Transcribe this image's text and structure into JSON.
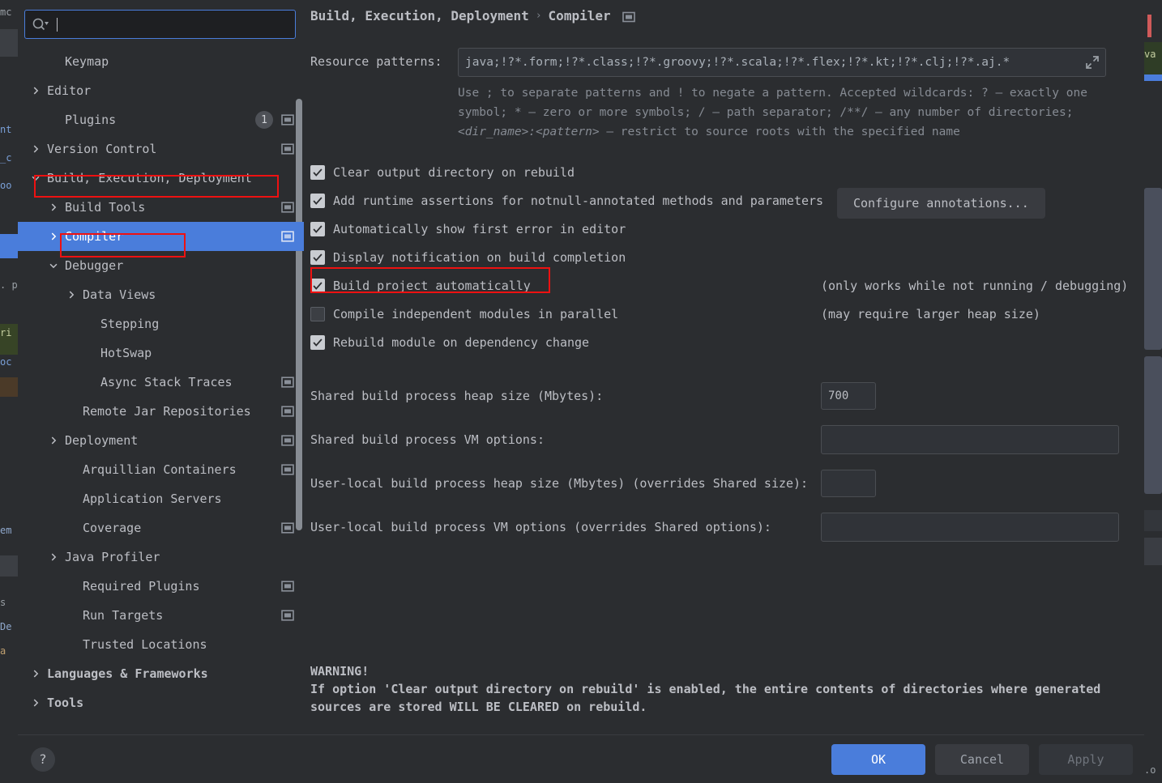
{
  "dialog": {
    "search": {
      "value": "",
      "placeholder": "",
      "icon": "search-icon"
    }
  },
  "sidebar": {
    "items": [
      {
        "label": "Keymap",
        "indent": 1,
        "arrow": "none",
        "badge": null,
        "cfg": false,
        "selected": false,
        "bold": false
      },
      {
        "label": "Editor",
        "indent": 0,
        "arrow": "right",
        "badge": null,
        "cfg": false,
        "selected": false,
        "bold": false
      },
      {
        "label": "Plugins",
        "indent": 1,
        "arrow": "none",
        "badge": "1",
        "cfg": true,
        "selected": false,
        "bold": false
      },
      {
        "label": "Version Control",
        "indent": 0,
        "arrow": "right",
        "badge": null,
        "cfg": true,
        "selected": false,
        "bold": false
      },
      {
        "label": "Build, Execution, Deployment",
        "indent": 0,
        "arrow": "down",
        "badge": null,
        "cfg": false,
        "selected": false,
        "bold": false
      },
      {
        "label": "Build Tools",
        "indent": 1,
        "arrow": "right",
        "badge": null,
        "cfg": true,
        "selected": false,
        "bold": false
      },
      {
        "label": "Compiler",
        "indent": 1,
        "arrow": "right",
        "badge": null,
        "cfg": true,
        "selected": true,
        "bold": false
      },
      {
        "label": "Debugger",
        "indent": 1,
        "arrow": "down",
        "badge": null,
        "cfg": false,
        "selected": false,
        "bold": false
      },
      {
        "label": "Data Views",
        "indent": 2,
        "arrow": "right",
        "badge": null,
        "cfg": false,
        "selected": false,
        "bold": false
      },
      {
        "label": "Stepping",
        "indent": 3,
        "arrow": "none",
        "badge": null,
        "cfg": false,
        "selected": false,
        "bold": false
      },
      {
        "label": "HotSwap",
        "indent": 3,
        "arrow": "none",
        "badge": null,
        "cfg": false,
        "selected": false,
        "bold": false
      },
      {
        "label": "Async Stack Traces",
        "indent": 3,
        "arrow": "none",
        "badge": null,
        "cfg": true,
        "selected": false,
        "bold": false
      },
      {
        "label": "Remote Jar Repositories",
        "indent": 2,
        "arrow": "none",
        "badge": null,
        "cfg": true,
        "selected": false,
        "bold": false
      },
      {
        "label": "Deployment",
        "indent": 1,
        "arrow": "right",
        "badge": null,
        "cfg": true,
        "selected": false,
        "bold": false
      },
      {
        "label": "Arquillian Containers",
        "indent": 2,
        "arrow": "none",
        "badge": null,
        "cfg": true,
        "selected": false,
        "bold": false
      },
      {
        "label": "Application Servers",
        "indent": 2,
        "arrow": "none",
        "badge": null,
        "cfg": false,
        "selected": false,
        "bold": false
      },
      {
        "label": "Coverage",
        "indent": 2,
        "arrow": "none",
        "badge": null,
        "cfg": true,
        "selected": false,
        "bold": false
      },
      {
        "label": "Java Profiler",
        "indent": 1,
        "arrow": "right",
        "badge": null,
        "cfg": false,
        "selected": false,
        "bold": false
      },
      {
        "label": "Required Plugins",
        "indent": 2,
        "arrow": "none",
        "badge": null,
        "cfg": true,
        "selected": false,
        "bold": false
      },
      {
        "label": "Run Targets",
        "indent": 2,
        "arrow": "none",
        "badge": null,
        "cfg": true,
        "selected": false,
        "bold": false
      },
      {
        "label": "Trusted Locations",
        "indent": 2,
        "arrow": "none",
        "badge": null,
        "cfg": false,
        "selected": false,
        "bold": false
      },
      {
        "label": "Languages & Frameworks",
        "indent": 0,
        "arrow": "right",
        "badge": null,
        "cfg": false,
        "selected": false,
        "bold": true
      },
      {
        "label": "Tools",
        "indent": 0,
        "arrow": "right",
        "badge": null,
        "cfg": false,
        "selected": false,
        "bold": true
      }
    ]
  },
  "main": {
    "breadcrumb": {
      "root": "Build, Execution, Deployment",
      "separator": "›",
      "leaf": "Compiler"
    },
    "resource_patterns": {
      "label": "Resource patterns:",
      "value": "*.java;!?*.form;!?*.class;!?*.groovy;!?*.scala;!?*.flex;!?*.kt;!?*.clj;!?*.aj",
      "expand_icon": "expand-icon"
    },
    "hint_line1": "Use ; to separate patterns and ! to negate a pattern. Accepted wildcards: ? — exactly one",
    "hint_line2": "symbol; * — zero or more symbols; / — path separator; /**/ — any number of directories;",
    "hint_line3_italic": "<dir_name>:<pattern>",
    "hint_line3_rest": " — restrict to source roots with the specified name",
    "checkboxes": [
      {
        "label": "Clear output directory on rebuild",
        "checked": true,
        "note": ""
      },
      {
        "label": "Add runtime assertions for notnull-annotated methods and parameters",
        "checked": true,
        "note": ""
      },
      {
        "label": "Automatically show first error in editor",
        "checked": true,
        "note": ""
      },
      {
        "label": "Display notification on build completion",
        "checked": true,
        "note": ""
      },
      {
        "label": "Build project automatically",
        "checked": true,
        "note": "(only works while not running / debugging)"
      },
      {
        "label": "Compile independent modules in parallel",
        "checked": false,
        "note": "(may require larger heap size)"
      },
      {
        "label": "Rebuild module on dependency change",
        "checked": true,
        "note": ""
      }
    ],
    "configure_annotations_label": "Configure annotations...",
    "fields": [
      {
        "label": "Shared build process heap size (Mbytes):",
        "value": "700",
        "size": "small"
      },
      {
        "label": "Shared build process VM options:",
        "value": "",
        "size": "wide"
      },
      {
        "label": "User-local build process heap size (Mbytes) (overrides Shared size):",
        "value": "",
        "size": "small"
      },
      {
        "label": "User-local build process VM options (overrides Shared options):",
        "value": "",
        "size": "wide"
      }
    ],
    "warning_title": "WARNING!",
    "warning_line1": "If option 'Clear output directory on rebuild' is enabled, the entire contents of directories where generated",
    "warning_line2": "sources are stored WILL BE CLEARED on rebuild."
  },
  "footer": {
    "help_label": "?",
    "ok_label": "OK",
    "cancel_label": "Cancel",
    "apply_label": "Apply"
  },
  "background": {
    "left_fragments": [
      "mc",
      "nt",
      "_c",
      "oo",
      ". p",
      "ri",
      "oc",
      "em",
      "s",
      "De",
      "a"
    ],
    "right_fragments": [
      "va",
      ".o"
    ]
  },
  "colors": {
    "accent": "#4a7ddb",
    "annotation": "#ee1111",
    "panel_bg": "#2b2d30",
    "field_bg": "#303338",
    "text": "#bcbec4",
    "muted": "#868b93"
  }
}
